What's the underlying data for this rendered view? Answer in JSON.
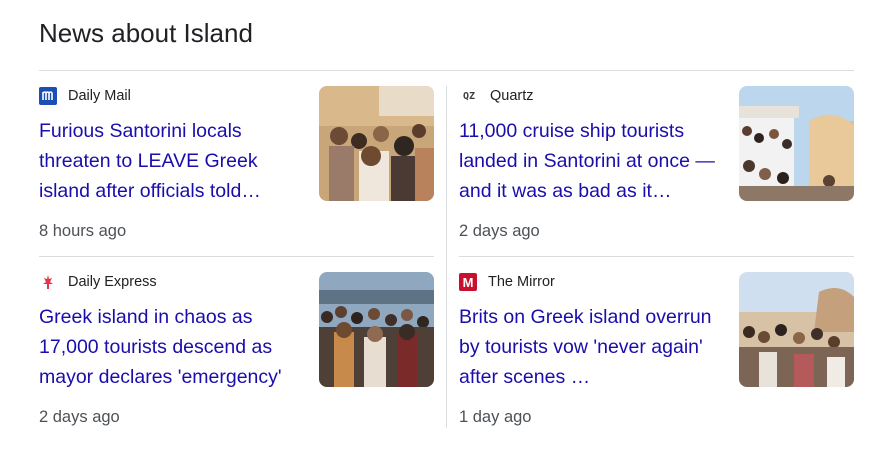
{
  "heading": "News about Island",
  "articles": [
    {
      "source": "Daily Mail",
      "logo_icon": "daily-mail-logo",
      "title": "Furious Santorini locals threaten to LEAVE Greek island after officials told…",
      "time": "8 hours ago"
    },
    {
      "source": "Quartz",
      "logo_icon": "quartz-logo",
      "logo_text": "QZ",
      "title": "11,000 cruise ship tourists landed in Santorini at once — and it was as bad as it…",
      "time": "2 days ago"
    },
    {
      "source": "Daily Express",
      "logo_icon": "daily-express-logo",
      "title": "Greek island in chaos as 17,000 tourists descend as mayor declares 'emergency'",
      "time": "2 days ago"
    },
    {
      "source": "The Mirror",
      "logo_icon": "mirror-logo",
      "logo_text": "M",
      "title": "Brits on Greek island overrun by tourists vow 'never again' after scenes …",
      "time": "1 day ago"
    }
  ],
  "colors": {
    "link": "#1a0dab",
    "meta": "#4d5156",
    "divider": "#dadce0",
    "daily_mail_blue": "#1b4fb3",
    "mirror_red": "#c8102e",
    "express_red": "#e2364a"
  }
}
